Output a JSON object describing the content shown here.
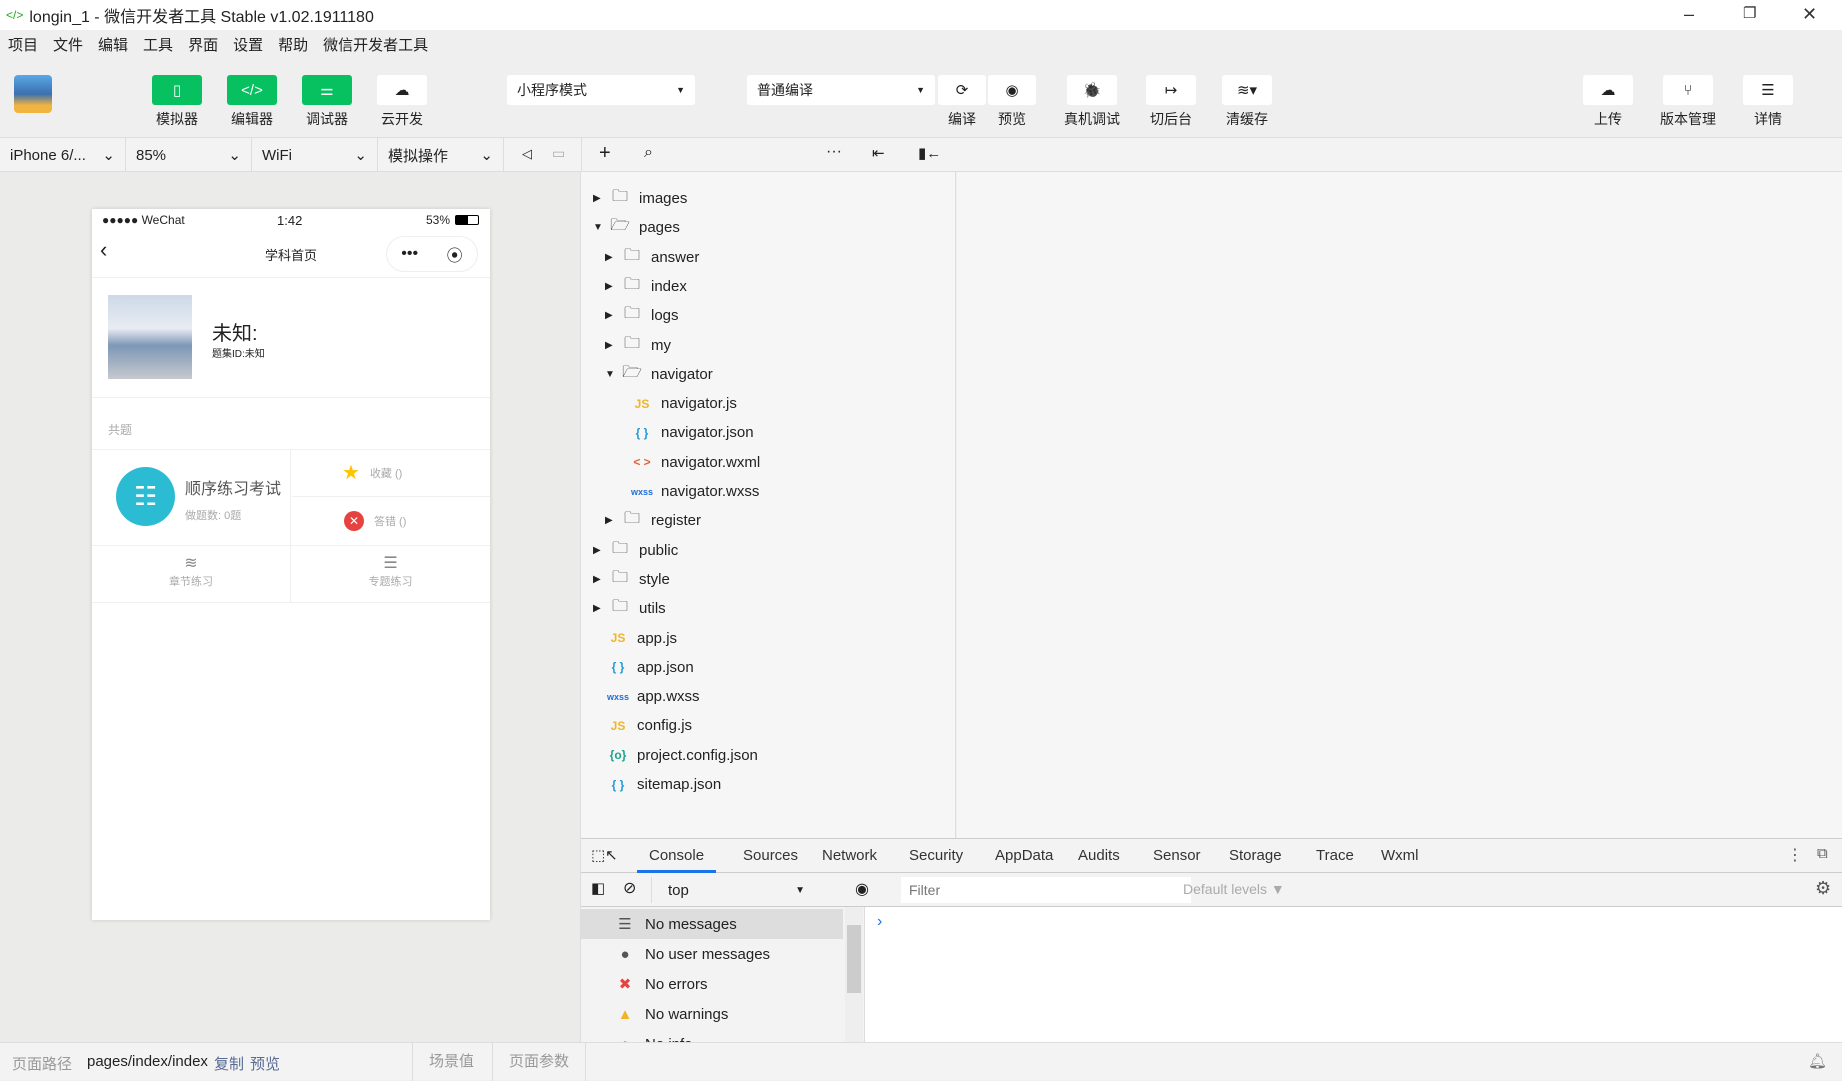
{
  "window": {
    "title": "longin_1 - 微信开发者工具 Stable v1.02.1911180",
    "icon": "code-icon",
    "minimize": "–",
    "restore": "❐",
    "close": "✕"
  },
  "menu": [
    "项目",
    "文件",
    "编辑",
    "工具",
    "界面",
    "设置",
    "帮助",
    "微信开发者工具"
  ],
  "toolbar": {
    "left": [
      {
        "label": "模拟器",
        "icon": "phone-icon",
        "glyph": "▯",
        "active": true
      },
      {
        "label": "编辑器",
        "icon": "code-icon",
        "glyph": "</>",
        "active": true
      },
      {
        "label": "调试器",
        "icon": "debug-sliders-icon",
        "glyph": "⚌",
        "active": true
      },
      {
        "label": "云开发",
        "icon": "cloud-dev-icon",
        "glyph": "☁",
        "active": false
      }
    ],
    "mode_select": "小程序模式",
    "compile_select": "普通编译",
    "mid": [
      {
        "label": "编译",
        "icon": "refresh-icon",
        "glyph": "⟳"
      },
      {
        "label": "预览",
        "icon": "eye-icon",
        "glyph": "◉"
      },
      {
        "label": "真机调试",
        "icon": "bug-icon",
        "glyph": "🐞"
      },
      {
        "label": "切后台",
        "icon": "switch-background-icon",
        "glyph": "↦"
      },
      {
        "label": "清缓存",
        "icon": "layers-icon",
        "glyph": "≋▾"
      }
    ],
    "right": [
      {
        "label": "上传",
        "icon": "cloud-upload-icon",
        "glyph": "☁"
      },
      {
        "label": "版本管理",
        "icon": "branch-icon",
        "glyph": "⑂"
      },
      {
        "label": "详情",
        "icon": "menu-icon",
        "glyph": "☰"
      }
    ]
  },
  "subbar": {
    "device": "iPhone 6/...",
    "zoom": "85%",
    "network": "WiFi",
    "simulate": "模拟操作"
  },
  "phone": {
    "carrier": "●●●●● WeChat",
    "time": "1:42",
    "battery": "53%",
    "battery_level": 53,
    "nav_title": "学科首页",
    "book_title": "未知:",
    "book_id": "题集ID:未知",
    "section": "共题",
    "practice_title": "顺序练习考试",
    "practice_sub": "做题数: 0题",
    "favorite": "收藏 ()",
    "wrong": "答错 ()",
    "chapter": "章节练习",
    "topic": "专题练习"
  },
  "tree": [
    {
      "name": "images",
      "type": "folder",
      "depth": 0,
      "open": false
    },
    {
      "name": "pages",
      "type": "folder",
      "depth": 0,
      "open": true
    },
    {
      "name": "answer",
      "type": "folder",
      "depth": 1,
      "open": false
    },
    {
      "name": "index",
      "type": "folder",
      "depth": 1,
      "open": false
    },
    {
      "name": "logs",
      "type": "folder",
      "depth": 1,
      "open": false
    },
    {
      "name": "my",
      "type": "folder",
      "depth": 1,
      "open": false
    },
    {
      "name": "navigator",
      "type": "folder",
      "depth": 1,
      "open": true
    },
    {
      "name": "navigator.js",
      "type": "js",
      "depth": 2
    },
    {
      "name": "navigator.json",
      "type": "json",
      "depth": 2
    },
    {
      "name": "navigator.wxml",
      "type": "wxml",
      "depth": 2
    },
    {
      "name": "navigator.wxss",
      "type": "wxss",
      "depth": 2
    },
    {
      "name": "register",
      "type": "folder",
      "depth": 1,
      "open": false
    },
    {
      "name": "public",
      "type": "folder",
      "depth": 0,
      "open": false
    },
    {
      "name": "style",
      "type": "folder",
      "depth": 0,
      "open": false
    },
    {
      "name": "utils",
      "type": "folder",
      "depth": 0,
      "open": false
    },
    {
      "name": "app.js",
      "type": "js",
      "depth": 0
    },
    {
      "name": "app.json",
      "type": "json",
      "depth": 0
    },
    {
      "name": "app.wxss",
      "type": "wxss",
      "depth": 0
    },
    {
      "name": "config.js",
      "type": "js",
      "depth": 0
    },
    {
      "name": "project.config.json",
      "type": "config",
      "depth": 0
    },
    {
      "name": "sitemap.json",
      "type": "json",
      "depth": 0
    }
  ],
  "devtools": {
    "tabs": [
      "Console",
      "Sources",
      "Network",
      "Security",
      "AppData",
      "Audits",
      "Sensor",
      "Storage",
      "Trace",
      "Wxml"
    ],
    "active_tab": "Console",
    "context": "top",
    "filter_placeholder": "Filter",
    "levels": "Default levels ▼",
    "sidebar": [
      {
        "label": "No messages",
        "icon": "list-icon"
      },
      {
        "label": "No user messages",
        "icon": "user-icon"
      },
      {
        "label": "No errors",
        "icon": "error-icon"
      },
      {
        "label": "No warnings",
        "icon": "warning-icon"
      },
      {
        "label": "No info",
        "icon": "info-icon"
      }
    ],
    "prompt": "›"
  },
  "status": {
    "path_label": "页面路径",
    "path": "pages/index/index",
    "copy": "复制",
    "preview": "预览",
    "scene": "场景值",
    "params": "页面参数"
  },
  "colors": {
    "accent": "#07c160",
    "tab_underline": "#1a73e8",
    "teal": "#2bbcd4",
    "error": "#e64340",
    "star": "#ffc300"
  }
}
